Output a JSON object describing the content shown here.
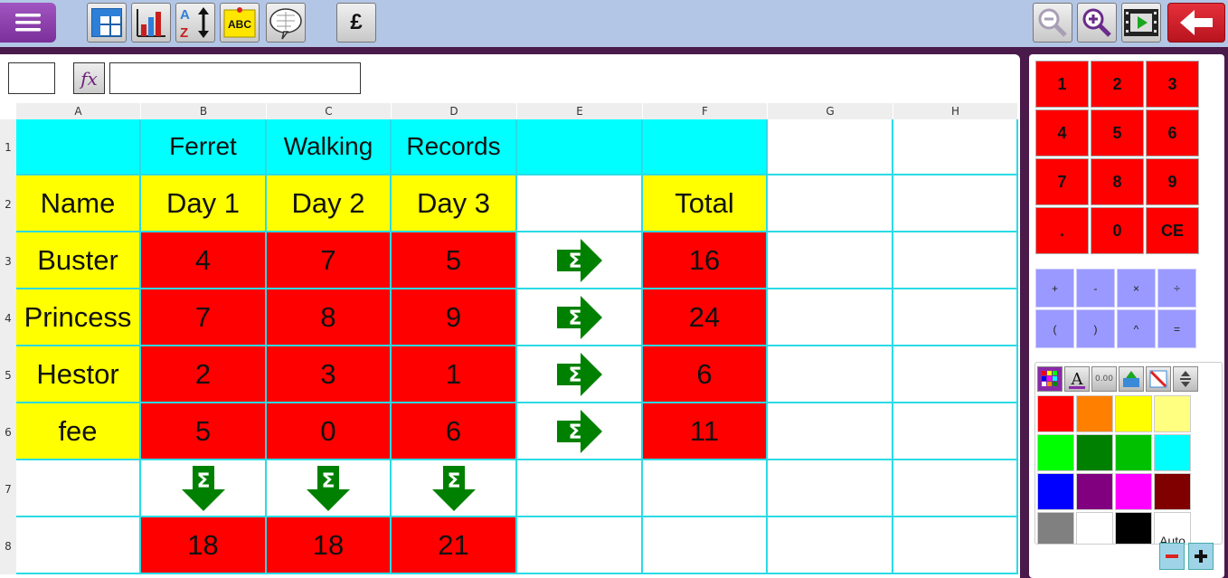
{
  "toolbar": {
    "currency_label": "£",
    "spellcheck_label": "ABC",
    "sort_label_a": "A",
    "sort_label_z": "Z"
  },
  "formula_bar": {
    "cell_ref": "",
    "fx_label": "fx",
    "formula": ""
  },
  "columns": [
    "A",
    "B",
    "C",
    "D",
    "E",
    "F",
    "G",
    "H"
  ],
  "rows": [
    "1",
    "2",
    "3",
    "4",
    "5",
    "6",
    "7",
    "8"
  ],
  "cells": {
    "r1": {
      "b": "Ferret",
      "c": "Walking",
      "d": "Records"
    },
    "r2": {
      "a": "Name",
      "b": "Day 1",
      "c": "Day 2",
      "d": "Day 3",
      "f": "Total"
    },
    "r3": {
      "a": "Buster",
      "b": "4",
      "c": "7",
      "d": "5",
      "f": "16"
    },
    "r4": {
      "a": "Princess",
      "b": "7",
      "c": "8",
      "d": "9",
      "f": "24"
    },
    "r5": {
      "a": "Hestor",
      "b": "2",
      "c": "3",
      "d": "1",
      "f": "6"
    },
    "r6": {
      "a": "fee",
      "b": "5",
      "c": "0",
      "d": "6",
      "f": "11"
    },
    "r8": {
      "b": "18",
      "c": "18",
      "d": "21"
    }
  },
  "keypad": {
    "numbers": [
      "1",
      "2",
      "3",
      "4",
      "5",
      "6",
      "7",
      "8",
      "9",
      ".",
      "0",
      "CE"
    ],
    "operators": [
      "+",
      "-",
      "×",
      "÷",
      "(",
      ")",
      "^",
      "="
    ]
  },
  "format": {
    "number_format_label": "0.00",
    "auto_label": "Auto",
    "colors": [
      "#ff0000",
      "#ff8000",
      "#ffff00",
      "#ffff80",
      "#00ff00",
      "#008000",
      "#00c000",
      "#00ffff",
      "#0000ff",
      "#800080",
      "#ff00ff",
      "#800000",
      "#808080",
      "#ffffff",
      "#000000",
      "#ffffff"
    ]
  },
  "colors": {
    "header_cyan": "#00ffff",
    "label_yellow": "#ffff00",
    "value_red": "#ff0000",
    "sum_green": "#008000",
    "grid_line": "#2adbe6"
  }
}
